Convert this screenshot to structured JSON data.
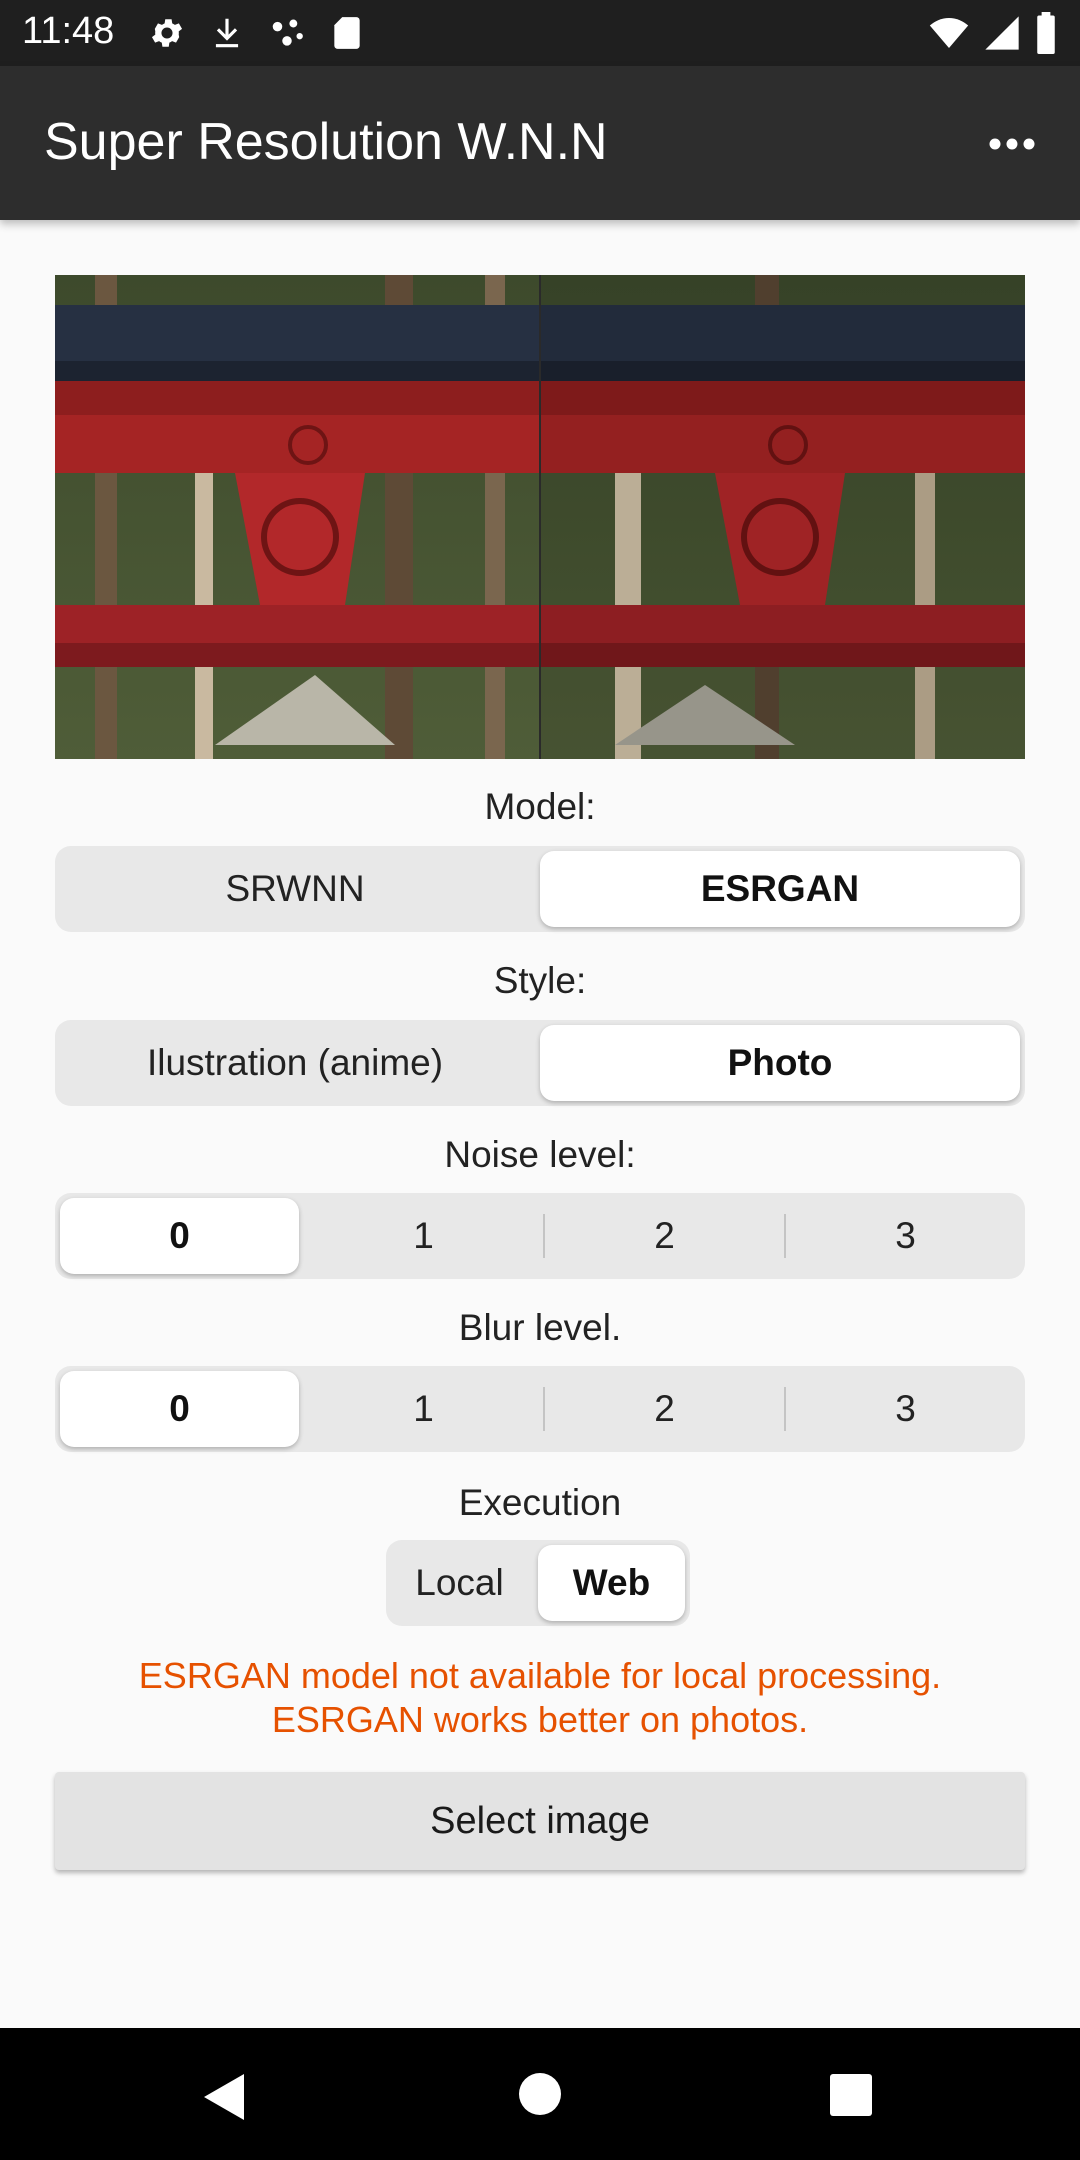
{
  "status_bar": {
    "time": "11:48",
    "left_icons": [
      "gear-icon",
      "download-icon",
      "dots-icon",
      "sd-card-icon"
    ],
    "right_icons": [
      "wifi-icon",
      "signal-icon",
      "battery-icon"
    ]
  },
  "app_bar": {
    "title": "Super Resolution W.N.N",
    "menu_icon": "overflow-menu-icon"
  },
  "model": {
    "label": "Model:",
    "options": [
      "SRWNN",
      "ESRGAN"
    ],
    "selected": "ESRGAN"
  },
  "style": {
    "label": "Style:",
    "options": [
      "Ilustration (anime)",
      "Photo"
    ],
    "selected": "Photo"
  },
  "noise": {
    "label": "Noise level:",
    "options": [
      "0",
      "1",
      "2",
      "3"
    ],
    "selected": "0"
  },
  "blur": {
    "label": "Blur level.",
    "options": [
      "0",
      "1",
      "2",
      "3"
    ],
    "selected": "0"
  },
  "execution": {
    "label": "Execution",
    "options": [
      "Local",
      "Web"
    ],
    "selected": "Web"
  },
  "warning": {
    "line1": "ESRGAN model not available for local processing.",
    "line2": "ESRGAN works better on photos."
  },
  "select_button": {
    "label": "Select image"
  },
  "nav_bar": {
    "icons": [
      "back-icon",
      "home-icon",
      "recents-icon"
    ]
  },
  "colors": {
    "warning": "#e65100",
    "app_bar": "#2d2d2d"
  }
}
